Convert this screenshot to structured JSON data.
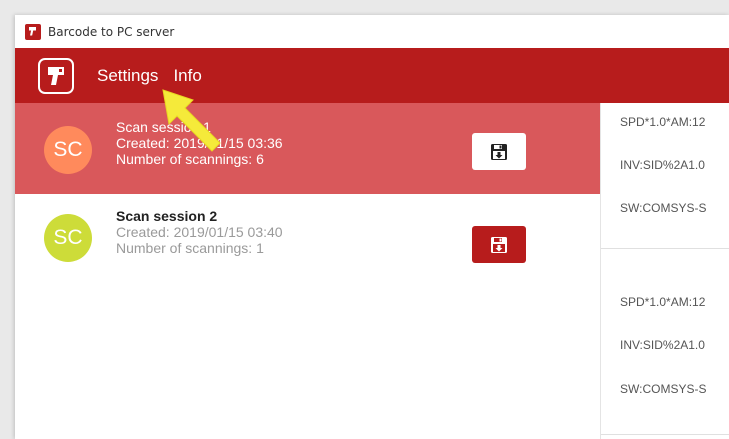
{
  "window": {
    "title": "Barcode to PC server"
  },
  "appbar": {
    "menu": [
      {
        "label": "Settings"
      },
      {
        "label": "Info"
      }
    ],
    "accent_color": "#b71c1c"
  },
  "sessions": [
    {
      "avatar": "SC",
      "name": "Scan session 1",
      "created": "Created: 2019/01/15 03:36",
      "count": "Number of scannings: 6",
      "selected": true,
      "avatar_color": "#ff8a5c",
      "save_icon": "save-export-icon"
    },
    {
      "avatar": "SC",
      "name": "Scan session 2",
      "created": "Created: 2019/01/15 03:40",
      "count": "Number of scannings: 1",
      "selected": false,
      "avatar_color": "#cddc39",
      "save_icon": "save-export-icon"
    }
  ],
  "scans": [
    "SPD*1.0*AM:12",
    "INV:SID%2A1.0",
    "SW:COMSYS-S",
    "SPD*1.0*AM:12",
    "INV:SID%2A1.0",
    "SW:COMSYS-S"
  ],
  "colors": {
    "selected_row": "#d9585b",
    "highlight_arrow": "#f5ea3a"
  }
}
